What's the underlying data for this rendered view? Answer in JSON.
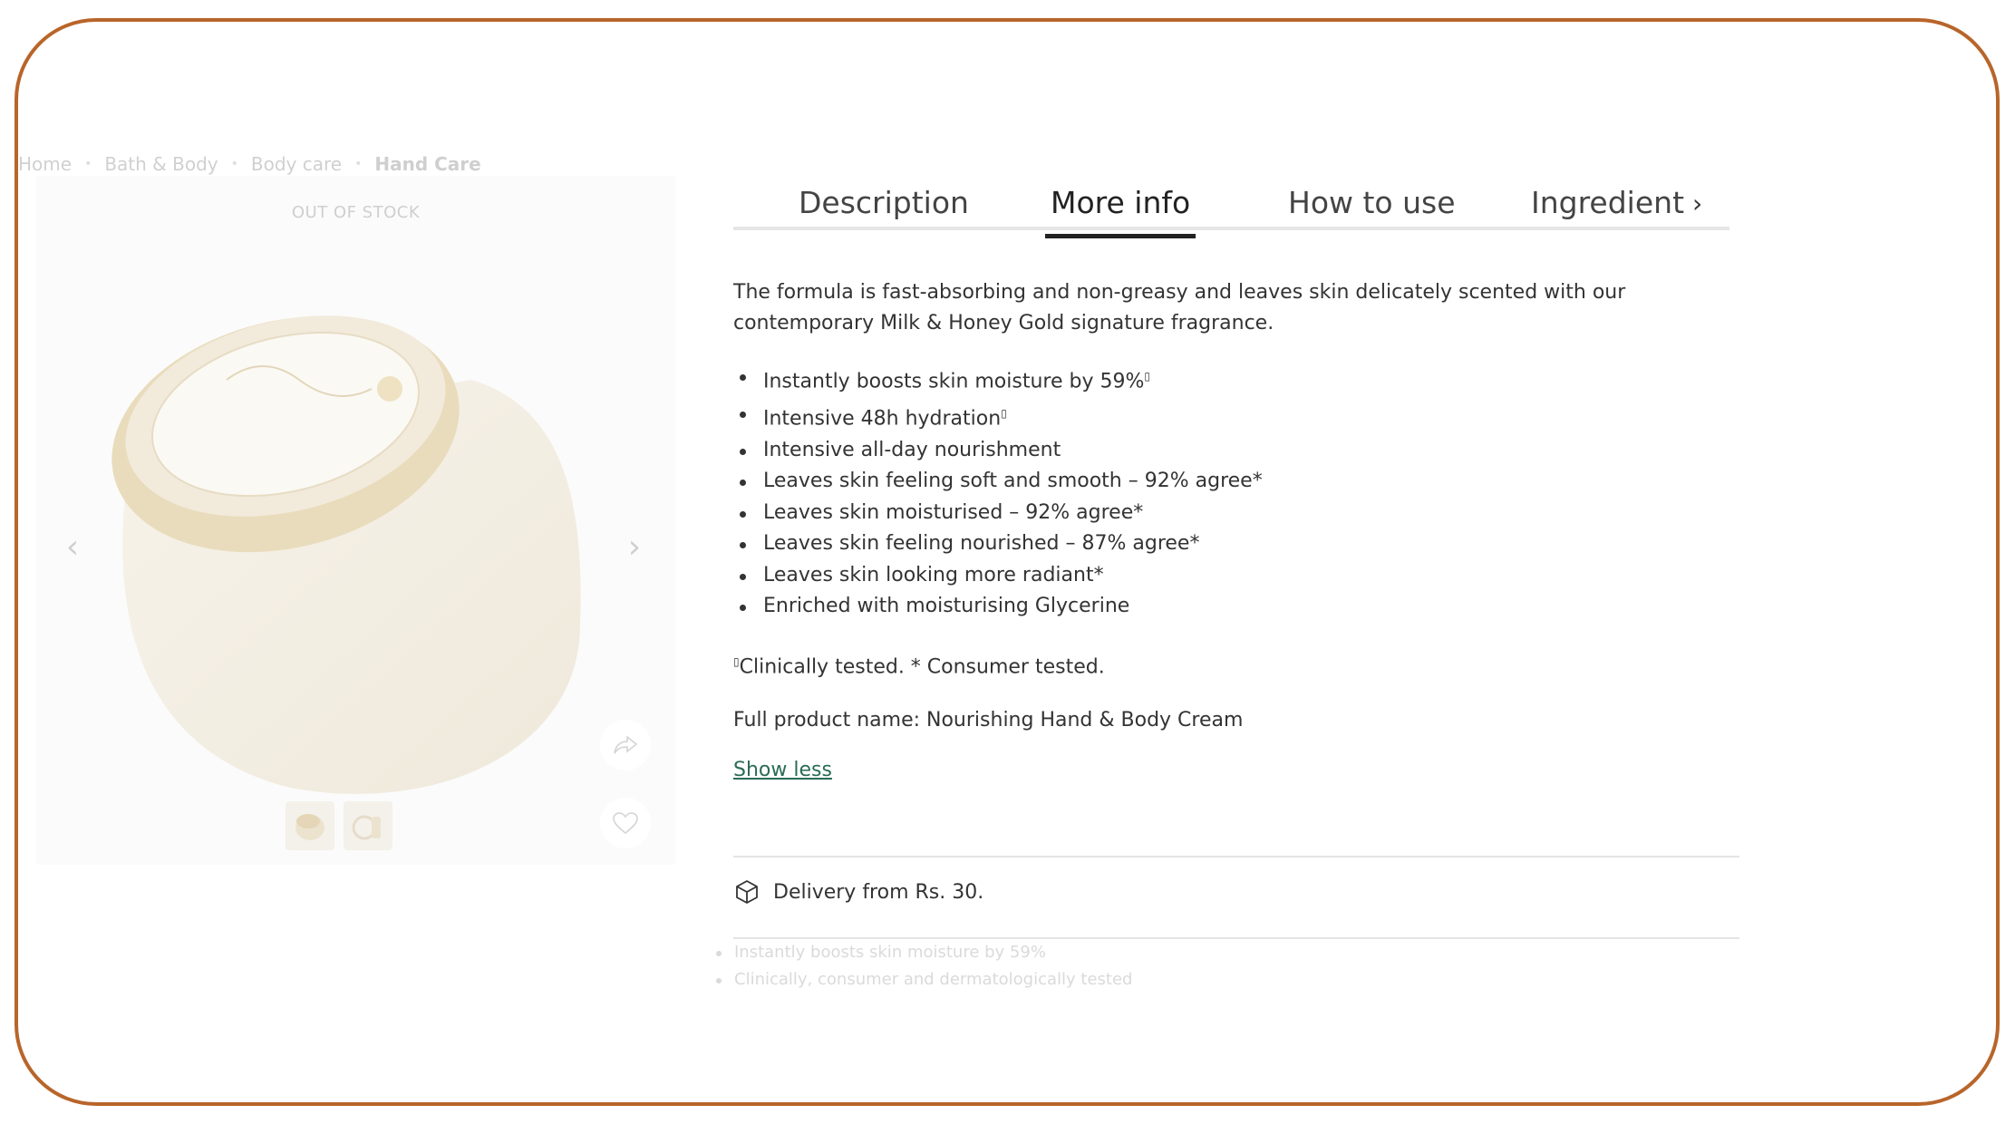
{
  "breadcrumb": [
    "Home",
    "Bath & Body",
    "Body care",
    "Hand Care"
  ],
  "product": {
    "stock_status": "OUT OF STOCK"
  },
  "tabs": {
    "description": "Description",
    "more_info": "More info",
    "how_to_use": "How to use",
    "ingredient": "Ingredient"
  },
  "info": {
    "intro": "The formula is fast-absorbing and non-greasy and leaves skin delicately scented with our contemporary Milk & Honey Gold signature fragrance.",
    "bullets": [
      "Instantly boosts skin moisture by 59%",
      "Intensive 48h hydration",
      "Intensive all-day nourishment",
      "Leaves skin feeling soft and smooth – 92% agree*",
      "Leaves skin moisturised – 92% agree*",
      "Leaves skin feeling nourished – 87% agree*",
      "Leaves skin looking more radiant*",
      "Enriched with moisturising Glycerine"
    ],
    "sup_mark": "▯",
    "footnote": "Clinically tested. * Consumer tested.",
    "full_name": "Full product name: Nourishing Hand & Body Cream",
    "show_less": "Show less"
  },
  "delivery": {
    "text": "Delivery from Rs. 30."
  },
  "faded_bullets": [
    "Instantly boosts skin moisture by 59%",
    "Clinically, consumer and dermatologically tested"
  ],
  "icons": {
    "share": "share-icon",
    "wishlist": "heart-icon",
    "delivery": "package-icon",
    "prev": "chevron-left-icon",
    "next": "chevron-right-icon"
  },
  "colors": {
    "frame": "#b8652a",
    "link": "#2b6b55",
    "jar_lid": "#e9dcbc"
  }
}
